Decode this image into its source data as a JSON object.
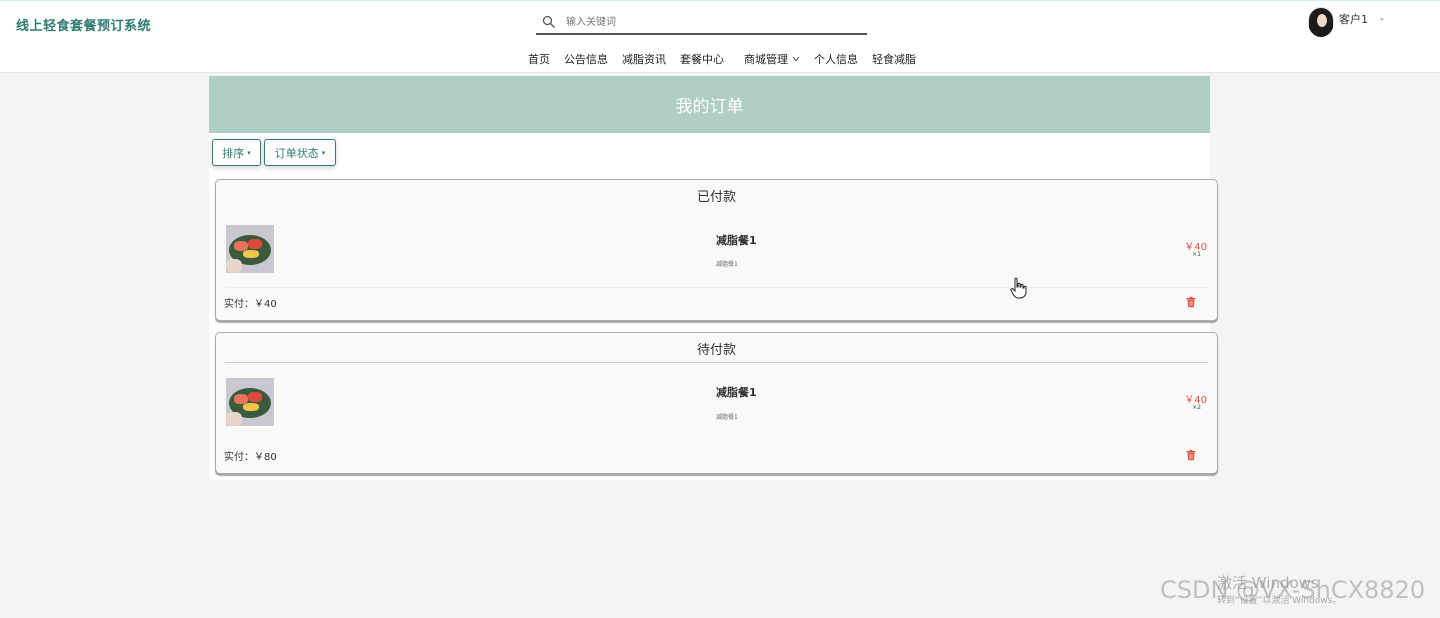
{
  "header": {
    "site_title": "线上轻食套餐预订系统",
    "search_placeholder": "输入关键词",
    "user_name": "客户1",
    "user_caret": "-"
  },
  "nav": {
    "items": [
      "首页",
      "公告信息",
      "减脂资讯",
      "套餐中心"
    ],
    "dropdown": "商城管理",
    "items_after": [
      "个人信息",
      "轻食减脂"
    ]
  },
  "page": {
    "banner_title": "我的订单",
    "sort_label": "排序",
    "status_filter_label": "订单状态",
    "caret": "▾"
  },
  "orders": [
    {
      "status": "已付款",
      "product_name": "减脂餐1",
      "product_desc": "减脂餐1",
      "price": "￥40",
      "qty": "×1",
      "paid_text": "实付：￥40"
    },
    {
      "status": "待付款",
      "product_name": "减脂餐1",
      "product_desc": "减脂餐1",
      "price": "￥40",
      "qty": "×2",
      "paid_text": "实付：￥80"
    }
  ],
  "watermark": {
    "activate": "激活 Windows",
    "activate_sub": "转到“设置”以激活 Windows。",
    "csdn": "CSDN @VX-ShCX8820"
  },
  "colors": {
    "brand": "#2e7d73",
    "banner": "#afcfc6",
    "price": "#e0533e",
    "trash": "#e0533e"
  }
}
